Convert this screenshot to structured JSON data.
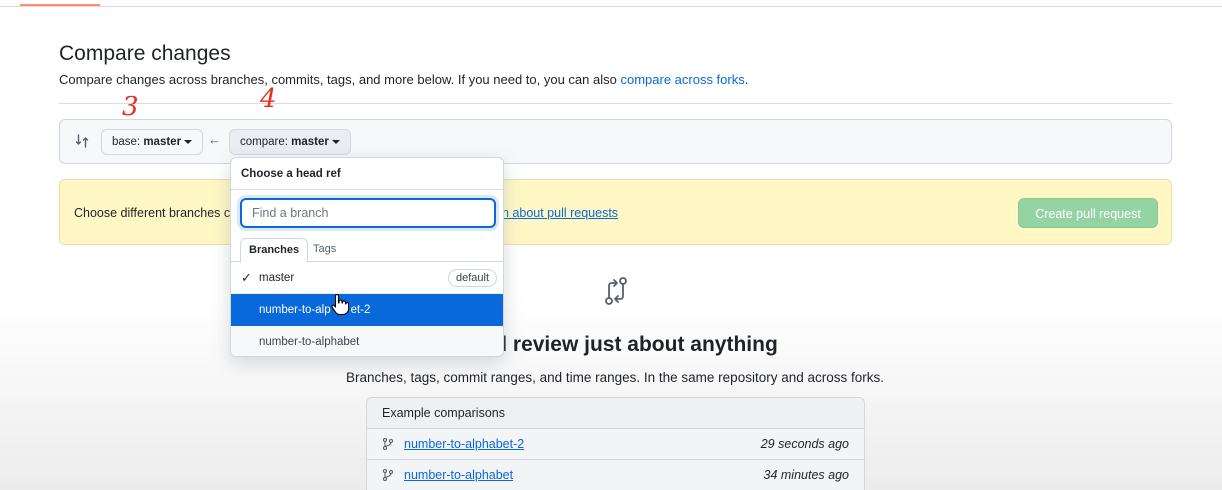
{
  "page": {
    "title": "Compare changes",
    "subtitle_text": "Compare changes across branches, commits, tags, and more below. If you need to, you can also ",
    "subtitle_link": "compare across forks",
    "subtitle_end": "."
  },
  "annotations": {
    "a3": "3",
    "a4": "4"
  },
  "range": {
    "base_prefix": "base: ",
    "base_value": "master",
    "compare_prefix": "compare: ",
    "compare_value": "master",
    "arrow": "←"
  },
  "flash": {
    "text": "Choose different branches c",
    "link": "n about pull requests",
    "create_button": "Create pull request"
  },
  "blankslate": {
    "title": "e and review just about anything",
    "subtitle": "Branches, tags, commit ranges, and time ranges. In the same repository and across forks."
  },
  "examples": {
    "header": "Example comparisons",
    "rows": [
      {
        "name": "number-to-alphabet-2",
        "time": "29 seconds ago"
      },
      {
        "name": "number-to-alphabet",
        "time": "34 minutes ago"
      }
    ]
  },
  "dropdown": {
    "header": "Choose a head ref",
    "filter_placeholder": "Find a branch",
    "tabs": {
      "branches": "Branches",
      "tags": "Tags"
    },
    "items": [
      {
        "name": "master",
        "checked": true,
        "badge": "default"
      },
      {
        "name": "number-to-alp",
        "name_rest": "et-2",
        "highlighted": true
      },
      {
        "name": "number-to-alphabet"
      }
    ]
  },
  "colors": {
    "link": "#0969da",
    "flash_bg": "#fff8c5",
    "create_button": "#94d3a2",
    "highlight": "#0969da",
    "annotation": "#e5301f"
  }
}
